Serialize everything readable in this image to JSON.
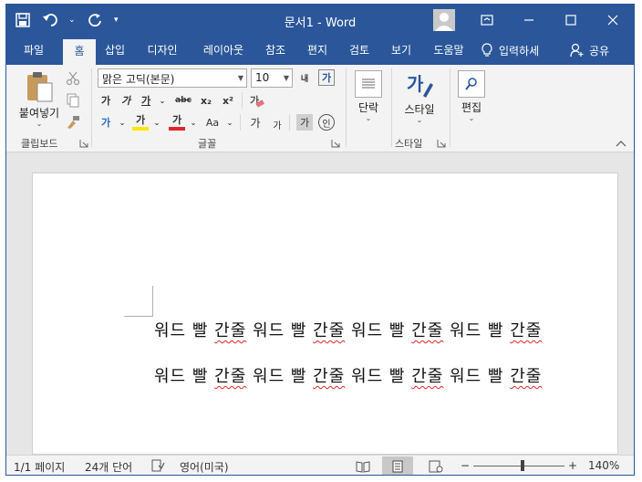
{
  "colors": {
    "brand": "#2b579a",
    "ribbon_bg": "#f3f3f3",
    "spell_error": "#e0262d"
  },
  "title_bar": {
    "document_name": "문서1",
    "separator": "-",
    "app_name": "Word",
    "qat_icons": [
      "save-icon",
      "undo-icon",
      "redo-icon",
      "customize-qat-icon"
    ],
    "window_controls": [
      "ribbon-display-options-icon",
      "minimize-icon",
      "maximize-icon",
      "close-icon"
    ]
  },
  "tabs": [
    "파일",
    "홈",
    "삽입",
    "디자인",
    "레이아웃",
    "참조",
    "편지",
    "검토",
    "보기",
    "도움말"
  ],
  "active_tab": "홈",
  "tell_me": "입력하세",
  "share": "공유",
  "ribbon": {
    "clipboard": {
      "paste_label": "붙여넣기",
      "group_label": "클립보드"
    },
    "font": {
      "font_name": "맑은 고딕(본문)",
      "font_size": "10",
      "group_label": "글꼴",
      "bold": "가",
      "italic": "가",
      "underline": "가",
      "strike": "abc",
      "subscript": "x₂",
      "superscript": "x²",
      "grow": "내",
      "phonetic": "가",
      "clear": "가",
      "text_effects": "가",
      "highlight": "가",
      "font_color": "가",
      "change_case": "Aa",
      "char_grow": "가",
      "char_shrink": "가",
      "char_shading": "가",
      "enclose": "인"
    },
    "paragraph": {
      "label": "단락"
    },
    "styles": {
      "label": "스타일",
      "group_label": "스타일"
    },
    "editing": {
      "label": "편집"
    }
  },
  "document": {
    "lines": [
      [
        "워드",
        "빨",
        "간줄",
        "워드",
        "빨",
        "간줄",
        "워드",
        "빨",
        "간줄",
        "워드",
        "빨",
        "간줄"
      ],
      [
        "워드",
        "빨",
        "간줄",
        "워드",
        "빨",
        "간줄",
        "워드",
        "빨",
        "간줄",
        "워드",
        "빨",
        "간줄"
      ]
    ]
  },
  "status_bar": {
    "page": "1/1 페이지",
    "words": "24개 단어",
    "language": "영어(미국)",
    "zoom_minus": "−",
    "zoom_plus": "+",
    "zoom": "140%",
    "zoom_percent_value": 140
  }
}
